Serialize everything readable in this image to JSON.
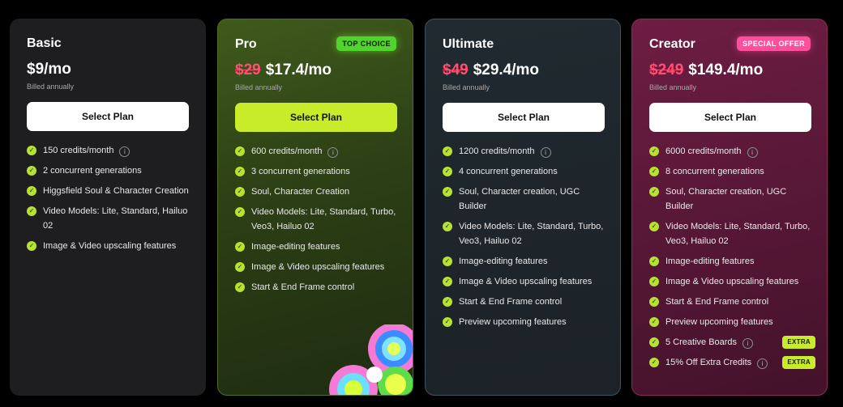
{
  "plans": [
    {
      "name": "Basic",
      "badge": "",
      "old_price": "",
      "price": "$9/mo",
      "billed": "Billed annually",
      "button": "Select Plan",
      "features": [
        {
          "text": "150 credits/month",
          "info": true
        },
        {
          "text": "2 concurrent generations"
        },
        {
          "text": "Higgsfield Soul & Character Creation"
        },
        {
          "text": "Video Models: Lite, Standard, Hailuo 02"
        },
        {
          "text": "Image & Video upscaling features"
        }
      ]
    },
    {
      "name": "Pro",
      "badge": "TOP CHOICE",
      "old_price": "$29",
      "price": "$17.4/mo",
      "billed": "Billed annually",
      "button": "Select Plan",
      "features": [
        {
          "text": "600 credits/month",
          "info": true
        },
        {
          "text": "3 concurrent generations"
        },
        {
          "text": "Soul, Character Creation"
        },
        {
          "text": "Video Models: Lite, Standard, Turbo, Veo3, Hailuo 02"
        },
        {
          "text": "Image-editing features"
        },
        {
          "text": "Image & Video upscaling features"
        },
        {
          "text": "Start & End Frame control"
        }
      ]
    },
    {
      "name": "Ultimate",
      "badge": "",
      "old_price": "$49",
      "price": "$29.4/mo",
      "billed": "Billed annually",
      "button": "Select Plan",
      "features": [
        {
          "text": "1200 credits/month",
          "info": true
        },
        {
          "text": "4 concurrent generations"
        },
        {
          "text": "Soul, Character creation, UGC Builder"
        },
        {
          "text": "Video Models: Lite, Standard, Turbo, Veo3, Hailuo 02"
        },
        {
          "text": "Image-editing features"
        },
        {
          "text": "Image & Video upscaling features"
        },
        {
          "text": "Start & End Frame control"
        },
        {
          "text": "Preview upcoming features"
        }
      ]
    },
    {
      "name": "Creator",
      "badge": "SPECIAL OFFER",
      "old_price": "$249",
      "price": "$149.4/mo",
      "billed": "Billed annually",
      "button": "Select Plan",
      "features": [
        {
          "text": "6000 credits/month",
          "info": true
        },
        {
          "text": "8 concurrent generations"
        },
        {
          "text": "Soul, Character creation, UGC Builder"
        },
        {
          "text": "Video Models: Lite, Standard, Turbo, Veo3, Hailuo 02"
        },
        {
          "text": "Image-editing features"
        },
        {
          "text": "Image & Video upscaling features"
        },
        {
          "text": "Start & End Frame control"
        },
        {
          "text": "Preview upcoming features"
        },
        {
          "text": "5 Creative Boards",
          "info": true,
          "extra": "EXTRA"
        },
        {
          "text": "15% Off Extra Credits",
          "info": true,
          "extra": "EXTRA"
        }
      ]
    }
  ],
  "icons": {
    "check": "check-circle-icon",
    "info": "info-icon",
    "decoration": "flower-decoration"
  },
  "colors": {
    "accent_lime": "#c8ec2a",
    "strike_red": "#ff4f72",
    "top_choice_green": "#4fd52b",
    "special_offer_pink": "#ff4f9c"
  }
}
